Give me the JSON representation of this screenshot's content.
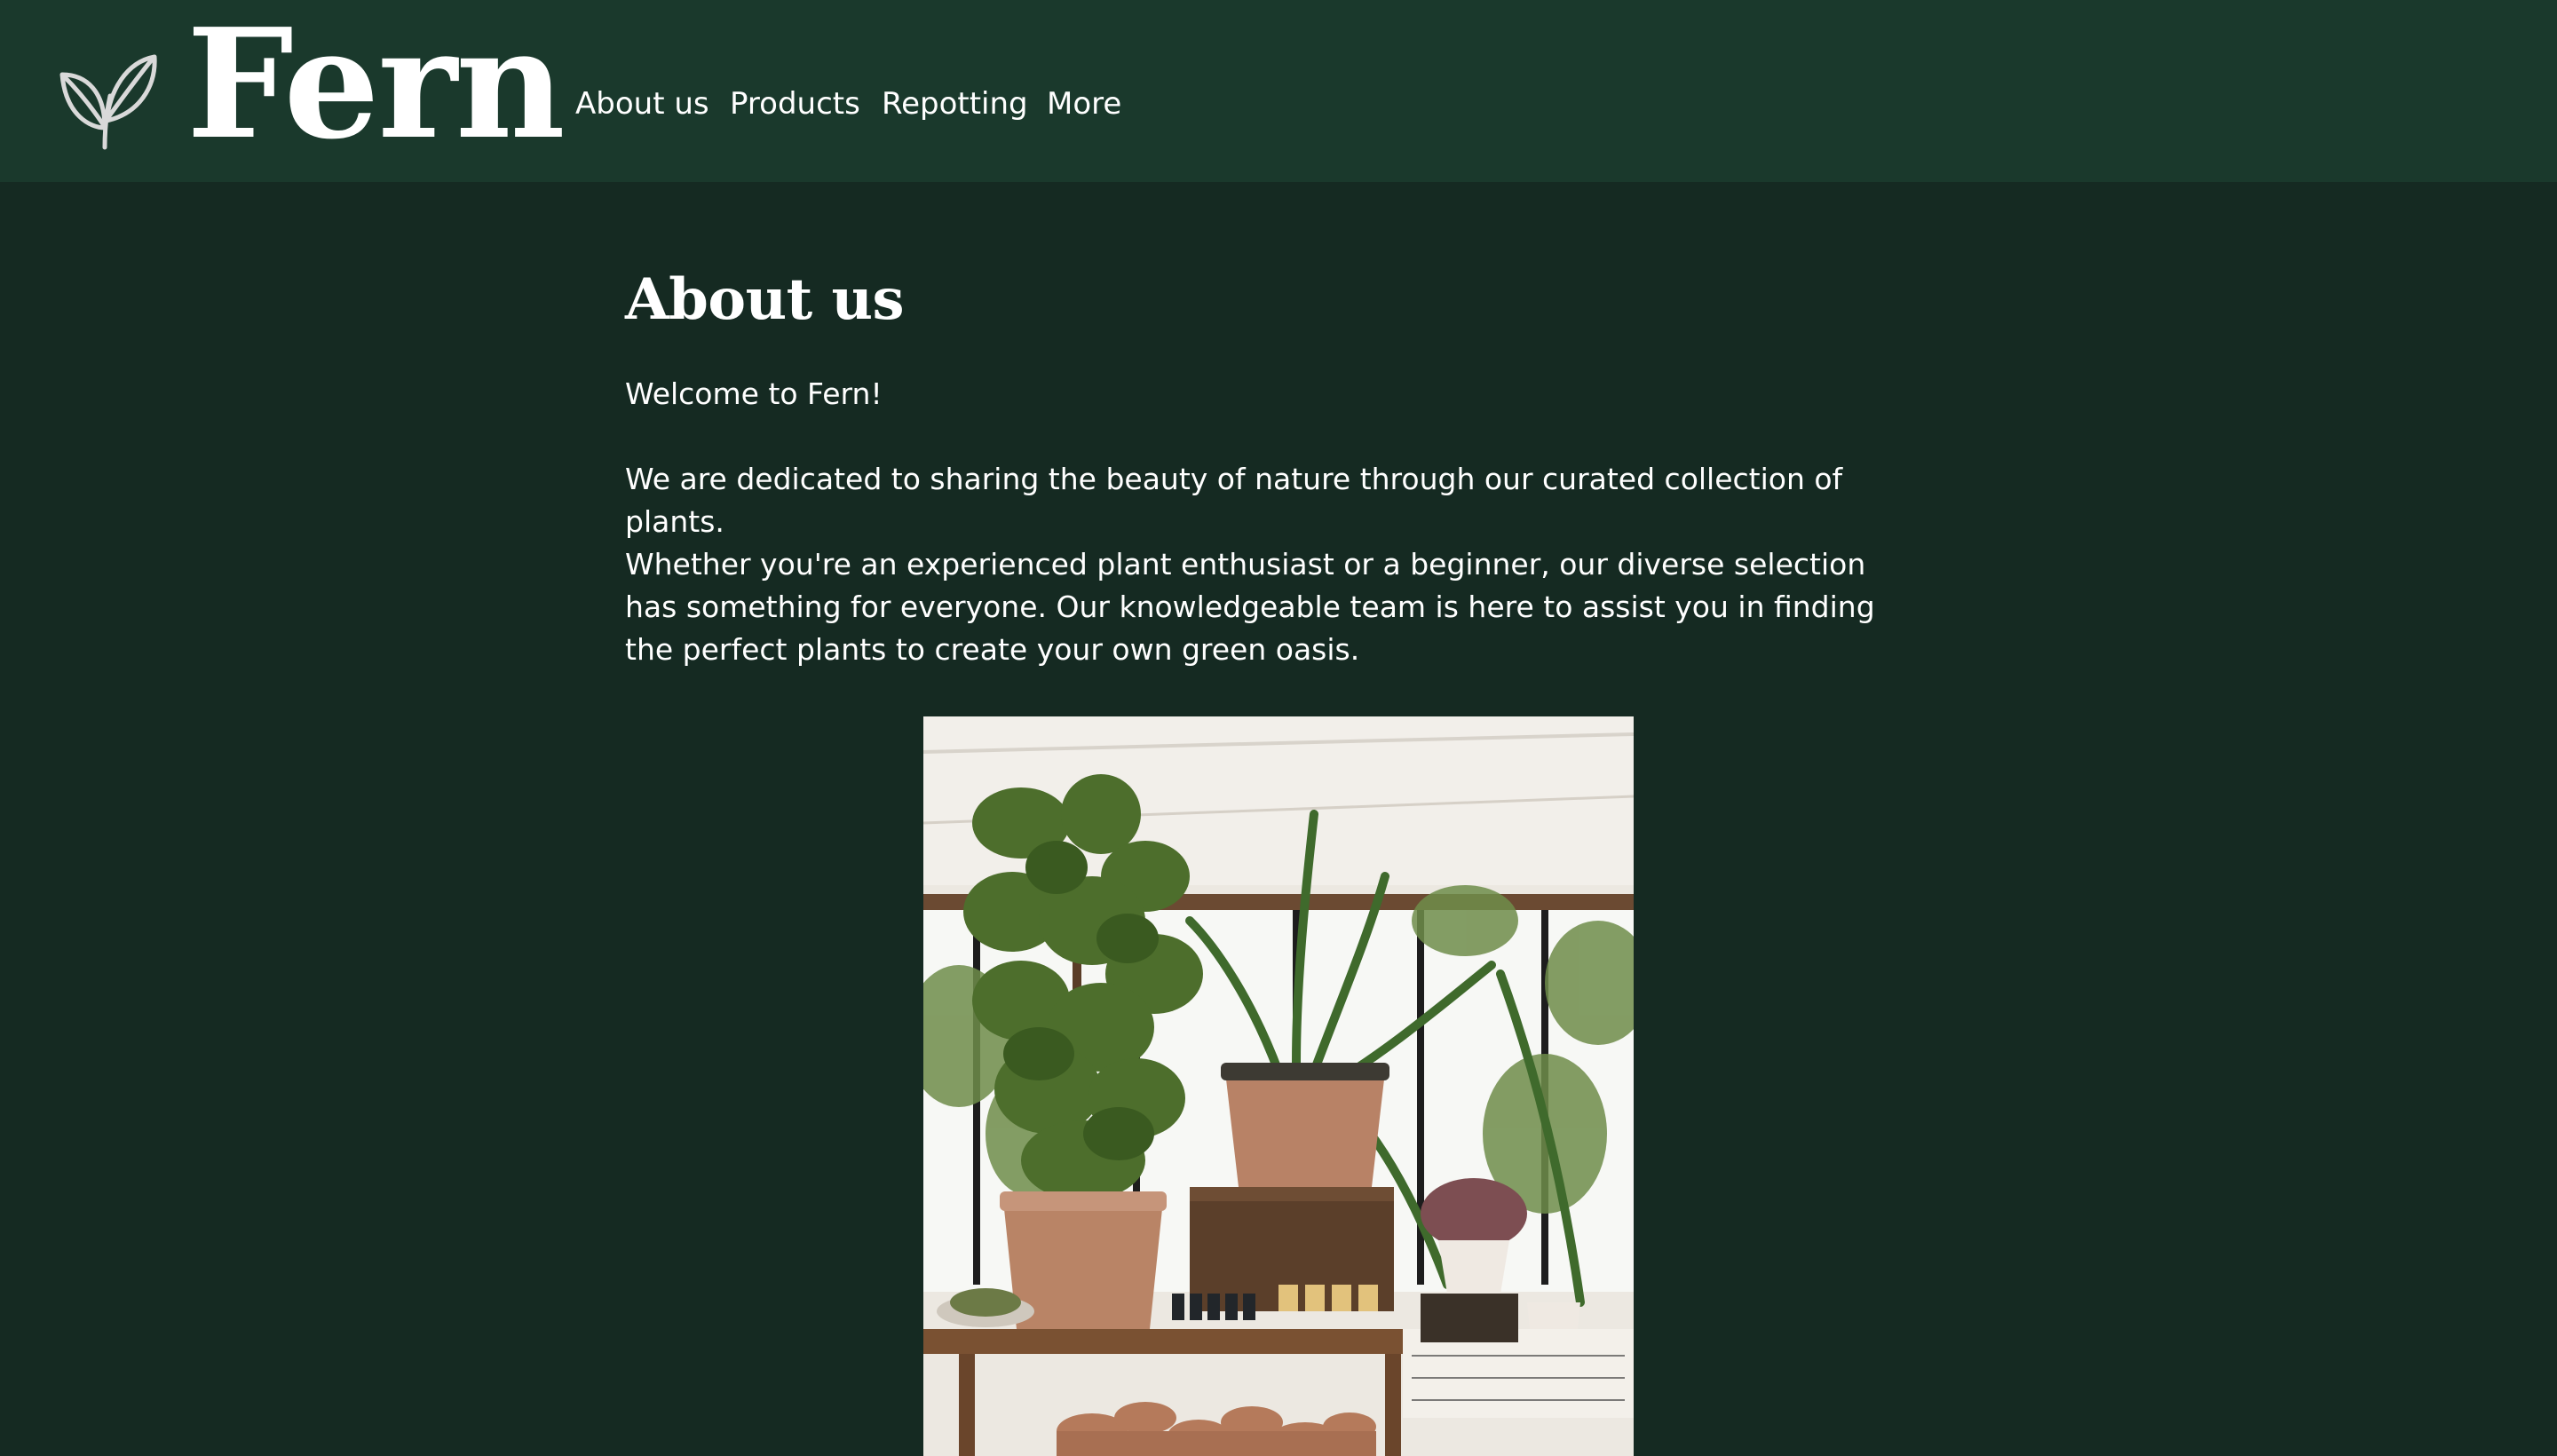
{
  "header": {
    "brand": "Fern",
    "logo_icon": "sprout-icon",
    "nav": [
      {
        "label": "About us"
      },
      {
        "label": "Products"
      },
      {
        "label": "Repotting"
      },
      {
        "label": "More"
      }
    ]
  },
  "main": {
    "title": "About us",
    "paragraphs": [
      "Welcome to Fern!",
      "We are dedicated to sharing the beauty of nature through our curated collection of plants.",
      "Whether you're an experienced plant enthusiast or a beginner, our diverse selection has something for everyone. Our knowledgeable team is here to assist you in finding the perfect plants to create your own green oasis."
    ],
    "image_subject": "plant-shop-photo"
  },
  "colors": {
    "header_bg": "#1a392c",
    "page_bg": "#152a22",
    "text": "#ffffff"
  }
}
